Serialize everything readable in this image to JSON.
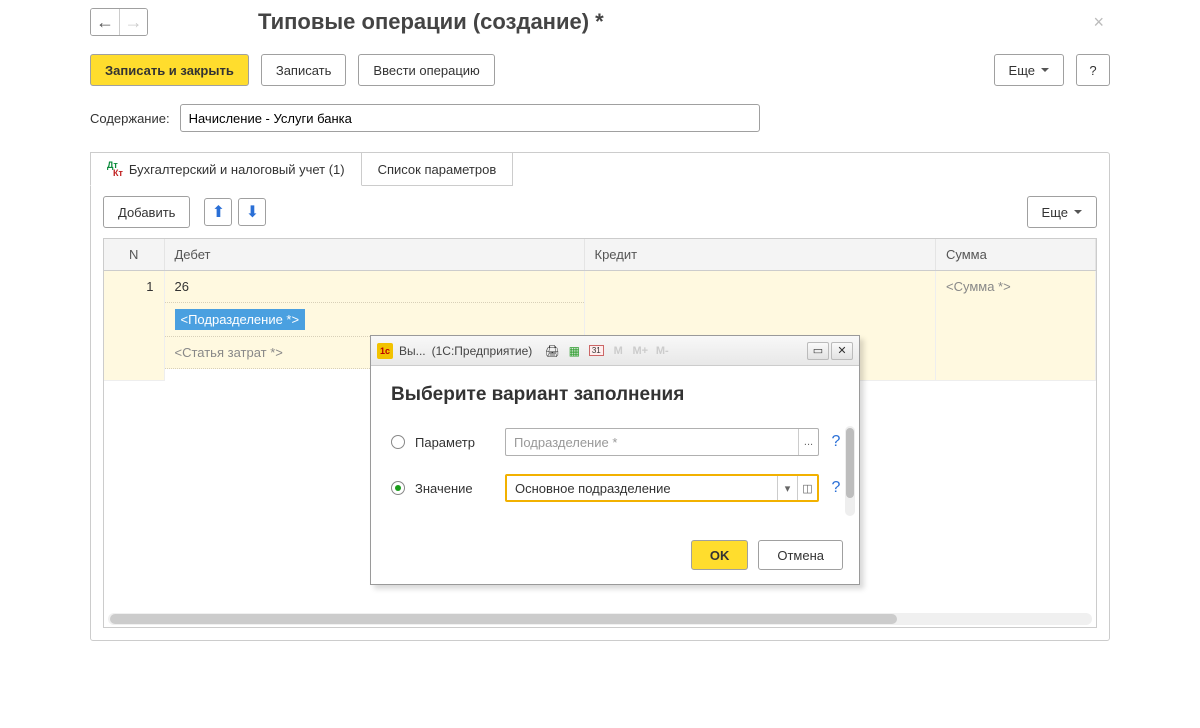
{
  "header": {
    "title": "Типовые операции (создание) *"
  },
  "toolbar": {
    "save_close": "Записать и закрыть",
    "save": "Записать",
    "enter_op": "Ввести операцию",
    "more": "Еще",
    "help": "?"
  },
  "fields": {
    "content_label": "Содержание:",
    "content_value": "Начисление - Услуги банка"
  },
  "tabs": {
    "accounting": "Бухгалтерский и налоговый учет (1)",
    "params": "Список параметров"
  },
  "panel": {
    "add": "Добавить",
    "more": "Еще"
  },
  "table": {
    "columns": {
      "n": "N",
      "debit": "Дебет",
      "credit": "Кредит",
      "sum": "Сумма"
    },
    "rows": [
      {
        "n": "1",
        "debit_account": "26",
        "debit_subdivision": "<Подразделение *>",
        "debit_cost_item": "<Статья затрат *>",
        "sum": "<Сумма *>"
      }
    ]
  },
  "dialog": {
    "app_short": "Вы...",
    "app_long": "(1С:Предприятие)",
    "m": "M",
    "mplus": "M+",
    "mminus": "M-",
    "heading": "Выберите вариант заполнения",
    "opt_param_label": "Параметр",
    "opt_param_placeholder": "Подразделение *",
    "opt_param_more": "...",
    "opt_value_label": "Значение",
    "opt_value_text": "Основное подразделение",
    "ok": "OK",
    "cancel": "Отмена",
    "help": "?"
  }
}
